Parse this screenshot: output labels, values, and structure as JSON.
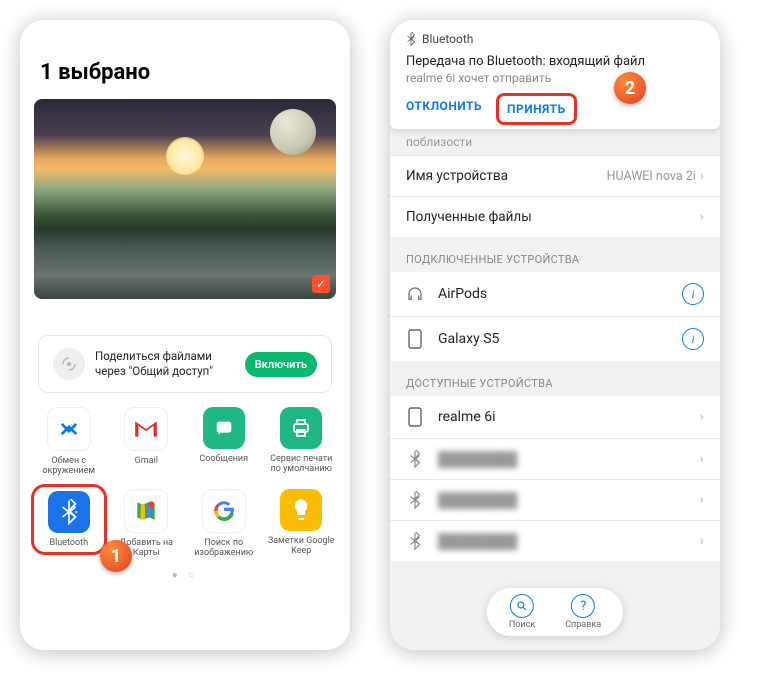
{
  "left": {
    "title": "1 выбрано",
    "share": {
      "text": "Поделиться файлами через \"Общий доступ\"",
      "button": "Включить"
    },
    "row1": [
      {
        "label": "Обмен с окружением",
        "bg": "#ffffff",
        "fg": "#0a7ae8",
        "glyph": "nearby"
      },
      {
        "label": "Gmail",
        "bg": "#ffffff",
        "fg": "#d93025",
        "glyph": "gmail"
      },
      {
        "label": "Сообщения",
        "bg": "#1fb785",
        "fg": "#ffffff",
        "glyph": "chat"
      },
      {
        "label": "Сервис печати по умолчанию",
        "bg": "#1fb785",
        "fg": "#ffffff",
        "glyph": "print"
      }
    ],
    "row2": [
      {
        "label": "Bluetooth",
        "bg": "#1a73e8",
        "fg": "#ffffff",
        "glyph": "bt"
      },
      {
        "label": "Добавить на Карты",
        "bg": "#ffffff",
        "fg": "#34a853",
        "glyph": "maps"
      },
      {
        "label": "Поиск по изображению",
        "bg": "#ffffff",
        "fg": "#4285f4",
        "glyph": "google"
      },
      {
        "label": "Заметки Google Keep",
        "bg": "#fbbc04",
        "fg": "#ffffff",
        "glyph": "keep"
      }
    ],
    "callout": "1"
  },
  "right": {
    "dialog": {
      "title": "Bluetooth",
      "body": "Передача по Bluetooth: входящий файл",
      "sub": "realme 6i хочет отправить",
      "decline": "ОТКЛОНИТЬ",
      "accept": "ПРИНЯТЬ"
    },
    "proximity": "поблизости",
    "device_name_label": "Имя устройства",
    "device_name_value": "HUAWEI nova 2i",
    "received_label": "Полученные файлы",
    "section_connected": "ПОДКЛЮЧЕННЫЕ УСТРОЙСТВА",
    "connected": [
      {
        "name": "AirPods",
        "icon": "headphones"
      },
      {
        "name": "Galaxy S5",
        "icon": "phone"
      }
    ],
    "section_available": "ДОСТУПНЫЕ УСТРОЙСТВА",
    "available": [
      {
        "name": "realme 6i",
        "icon": "phone",
        "blur": false
      },
      {
        "name": "████████",
        "icon": "bt",
        "blur": true
      },
      {
        "name": "████████",
        "icon": "bt",
        "blur": true
      },
      {
        "name": "████████",
        "icon": "bt",
        "blur": true
      }
    ],
    "pill": {
      "search": "Поиск",
      "help": "Справка"
    },
    "callout": "2"
  }
}
